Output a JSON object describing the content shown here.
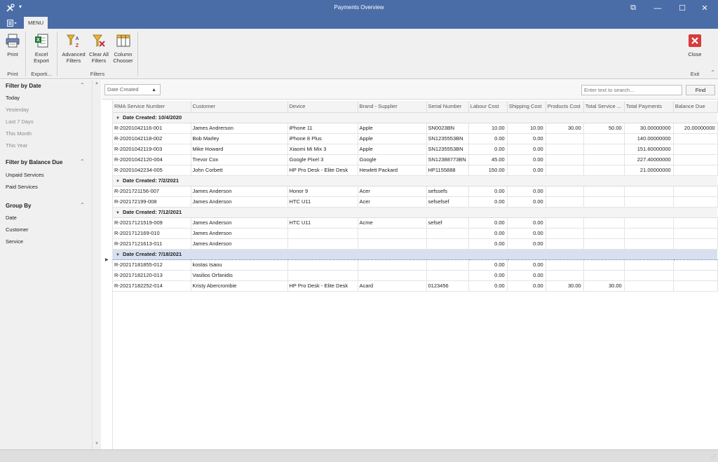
{
  "window": {
    "title": "Payments Overview",
    "controls": {
      "restore": "⧉",
      "minimize": "—",
      "maximize": "☐",
      "close": "✕"
    }
  },
  "ribbon": {
    "tab": "MENU",
    "buttons": {
      "print": [
        "Print"
      ],
      "excel_export": [
        "Excel",
        "Export"
      ],
      "advanced_filters": [
        "Advanced",
        "Filters"
      ],
      "clear_all_filters": [
        "Clear All",
        "Filters"
      ],
      "column_chooser": [
        "Column",
        "Chooser"
      ],
      "close": [
        "Close"
      ]
    },
    "groups": {
      "print": "Print",
      "export": "Exporti...",
      "filters": "Filters",
      "exit": "Exit"
    }
  },
  "left_panel": {
    "sections": {
      "date": {
        "title": "Filter by Date",
        "items": [
          "Today",
          "Yesterday",
          "Last 7 Days",
          "This Month",
          "This Year"
        ]
      },
      "balance": {
        "title": "Filter by Balance Due",
        "items": [
          "Unpaid Services",
          "Paid Services"
        ]
      },
      "group": {
        "title": "Group By",
        "items": [
          "Date",
          "Customer",
          "Service"
        ]
      }
    }
  },
  "grid_toolbar": {
    "group_chip": "Date Created",
    "search_placeholder": "Enter text to search...",
    "find_label": "Find"
  },
  "grid": {
    "columns": [
      "RMA Service Number",
      "Customer",
      "Device",
      "Brand - Supplier",
      "Serial Number",
      "Labour Cost",
      "Shipping Cost",
      "Products Cost",
      "Total Service ...",
      "Total Payments",
      "Balance Due"
    ],
    "groups": [
      {
        "label": "Date Created: 10/4/2020",
        "rows": [
          [
            "R-20201042116-001",
            "James Andrerson",
            "iPhone 11",
            "Apple",
            "SN0023BN",
            "10.00",
            "10.00",
            "30.00",
            "50.00",
            "30.00000000",
            "20.00000000"
          ],
          [
            "R-20201042118-002",
            "Bob Marley",
            "iPhone 8 Plus",
            "Apple",
            "SN1235553BN",
            "0.00",
            "0.00",
            "",
            "",
            "140.00000000",
            ""
          ],
          [
            "R-20201042119-003",
            "Mike Howard",
            "Xiaomi Mi Mix 3",
            "Apple",
            "SN1235553BN",
            "0.00",
            "0.00",
            "",
            "",
            "151.60000000",
            ""
          ],
          [
            "R-20201042120-004",
            "Trevor Cox",
            "Google Pixel 3",
            "Google",
            "SN12388773BN",
            "45.00",
            "0.00",
            "",
            "",
            "227.40000000",
            ""
          ],
          [
            "R-20201042234-005",
            "John Corbett",
            "HP Pro Desk - Elite Desk",
            "Hewlett Packard",
            "HP1155888",
            "150.00",
            "0.00",
            "",
            "",
            "21.00000000",
            ""
          ]
        ]
      },
      {
        "label": "Date Created: 7/2/2021",
        "rows": [
          [
            "R-2021721156-007",
            "James Anderson",
            "Honor 9",
            "Acer",
            "sefssefs",
            "0.00",
            "0.00",
            "",
            "",
            "",
            ""
          ],
          [
            "R-202172199-008",
            "James Anderson",
            "HTC U11",
            "Acer",
            "sefsefsef",
            "0.00",
            "0.00",
            "",
            "",
            "",
            ""
          ]
        ]
      },
      {
        "label": "Date Created: 7/12/2021",
        "rows": [
          [
            "R-20217121519-009",
            "James Anderson",
            "HTC U11",
            "Acme",
            "sefsef",
            "0.00",
            "0.00",
            "",
            "",
            "",
            ""
          ],
          [
            "R-2021712169-010",
            "James Anderson",
            "",
            "",
            "",
            "0.00",
            "0.00",
            "",
            "",
            "",
            ""
          ],
          [
            "R-20217121613-011",
            "James Anderson",
            "",
            "",
            "",
            "0.00",
            "0.00",
            "",
            "",
            "",
            ""
          ]
        ]
      },
      {
        "label": "Date Created: 7/18/2021",
        "selected": true,
        "rows": [
          [
            "R-20217181855-012",
            "kostas tsaou",
            "",
            "",
            "",
            "0.00",
            "0.00",
            "",
            "",
            "",
            ""
          ],
          [
            "R-20217182120-013",
            "Vasilios Orfanidis",
            "",
            "",
            "",
            "0.00",
            "0.00",
            "",
            "",
            "",
            ""
          ],
          [
            "R-20217182252-014",
            "Kristy Abercrombie",
            "HP Pro Desk - Elite Desk",
            "Acard",
            "0123456",
            "0.00",
            "0.00",
            "30.00",
            "30.00",
            "",
            ""
          ]
        ]
      }
    ]
  }
}
